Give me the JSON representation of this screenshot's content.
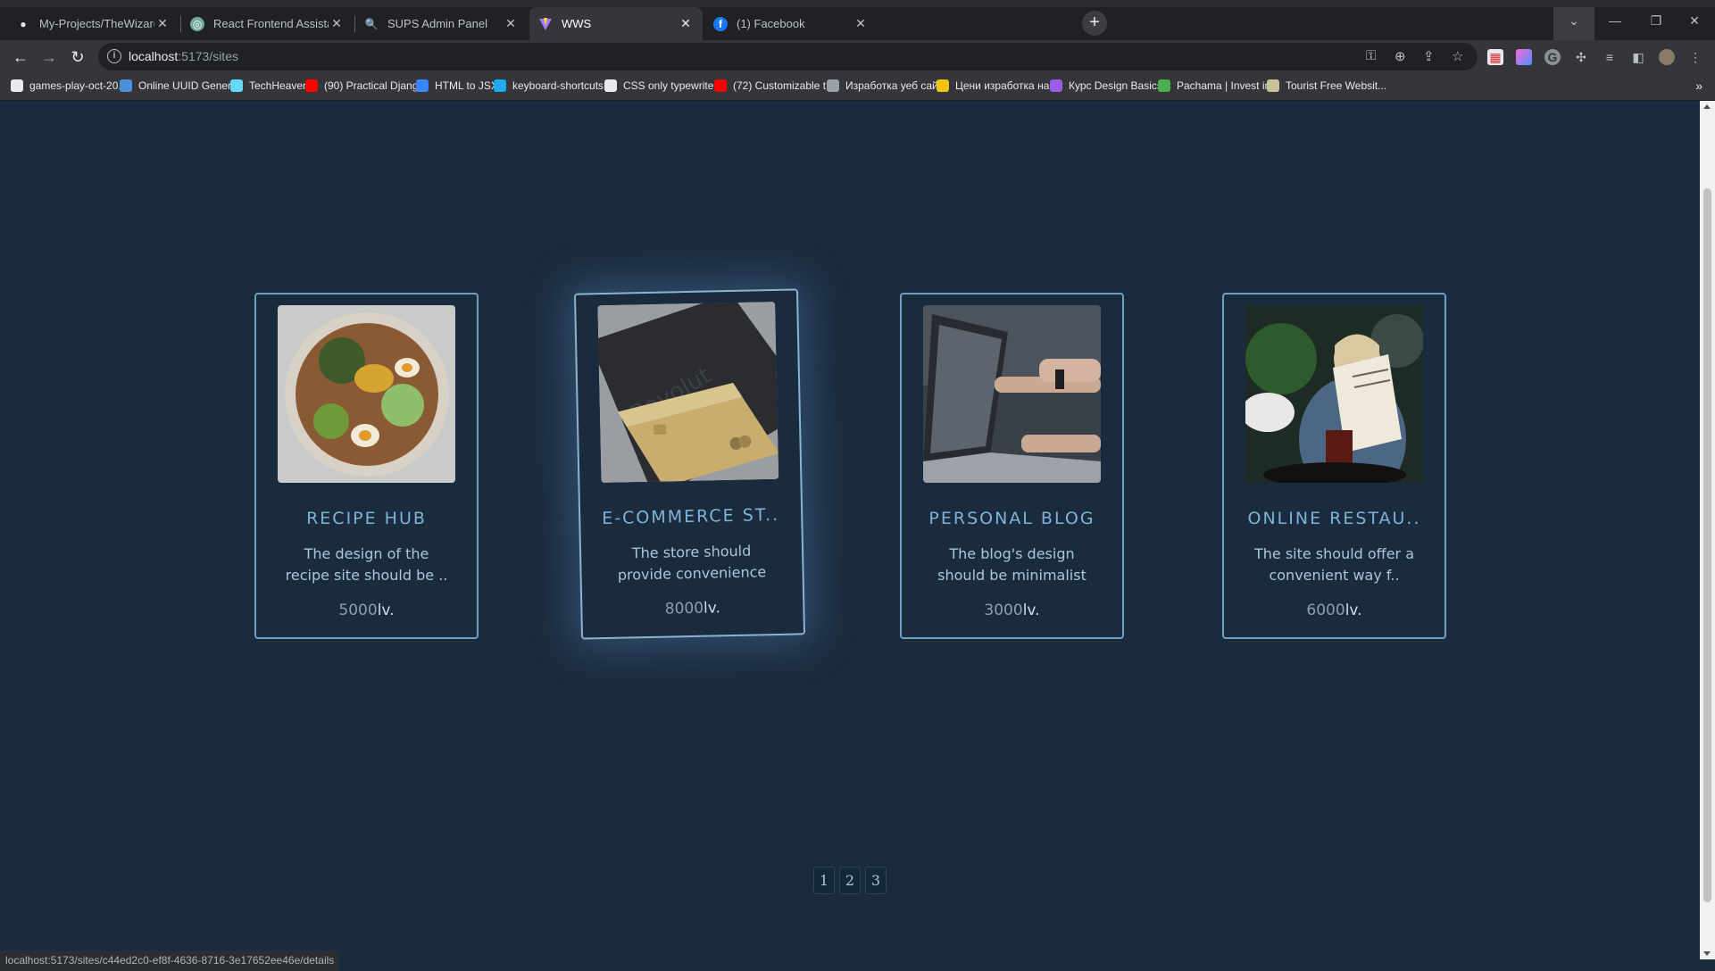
{
  "browser": {
    "tabs": [
      {
        "title": "My-Projects/TheWizardOfWebsi",
        "icon": "github-icon"
      },
      {
        "title": "React Frontend Assistance",
        "icon": "openai-icon"
      },
      {
        "title": "SUPS Admin Panel",
        "icon": "sups-icon"
      },
      {
        "title": "WWS",
        "icon": "vite-icon"
      },
      {
        "title": "(1) Facebook",
        "icon": "facebook-icon"
      }
    ],
    "close_glyph": "✕",
    "new_tab_glyph": "+",
    "url_host": "localhost",
    "url_path": ":5173/sites",
    "bookmarks": [
      {
        "label": "games-play-oct-20...",
        "icon": "github-icon",
        "color": "#e8eaed"
      },
      {
        "label": "Online UUID Gener...",
        "icon": "globe-icon",
        "color": "#4a8fd8"
      },
      {
        "label": "TechHeaven",
        "icon": "react-icon",
        "color": "#61dafb"
      },
      {
        "label": "(90) Practical Djang...",
        "icon": "youtube-icon",
        "color": "#ff0000"
      },
      {
        "label": "HTML to JSX",
        "icon": "transform-icon",
        "color": "#3a86ff"
      },
      {
        "label": "keyboard-shortcuts...",
        "icon": "vscode-icon",
        "color": "#23a9f2"
      },
      {
        "label": "CSS only typewriter...",
        "icon": "codepen-icon",
        "color": "#e8eaed"
      },
      {
        "label": "(72) Customizable t...",
        "icon": "youtube-icon",
        "color": "#ff0000"
      },
      {
        "label": "Изработка уеб сай...",
        "icon": "site-icon",
        "color": "#9aa0a6"
      },
      {
        "label": "Цени изработка на...",
        "icon": "bookmark-icon",
        "color": "#f4c20d"
      },
      {
        "label": "Курс Design Basics...",
        "icon": "course-icon",
        "color": "#9b5de5"
      },
      {
        "label": "Pachama | Invest in...",
        "icon": "pachama-icon",
        "color": "#4caf50"
      },
      {
        "label": "Tourist Free Websit...",
        "icon": "template-icon",
        "color": "#c9c19a"
      }
    ],
    "bookmarks_more": "»"
  },
  "sites": [
    {
      "name": "RECIPE HUB",
      "desc_line1": "The design of the",
      "desc_line2": "recipe site should be ..",
      "amount": "5000",
      "currency": "lv.",
      "image": "ramen-bowl"
    },
    {
      "name": "E-COMMERCE ST..",
      "desc_line1": "The store should",
      "desc_line2": "provide convenience",
      "amount": "8000",
      "currency": "lv.",
      "image": "revolut-card"
    },
    {
      "name": "PERSONAL BLOG",
      "desc_line1": "The blog's design",
      "desc_line2": "should be minimalist",
      "amount": "3000",
      "currency": "lv.",
      "image": "laptop-hands"
    },
    {
      "name": "ONLINE RESTAU..",
      "desc_line1": "The site should offer a",
      "desc_line2": "convenient way f..",
      "amount": "6000",
      "currency": "lv.",
      "image": "restaurant-menu"
    }
  ],
  "pagination": [
    "1",
    "2",
    "3"
  ],
  "status_url": "localhost:5173/sites/c44ed2c0-ef8f-4636-8716-3e17652ee46e/details",
  "colors": {
    "page_bg": "#1b2b3e",
    "card_border": "#6e9fc0",
    "card_title": "#7fb3d6"
  }
}
